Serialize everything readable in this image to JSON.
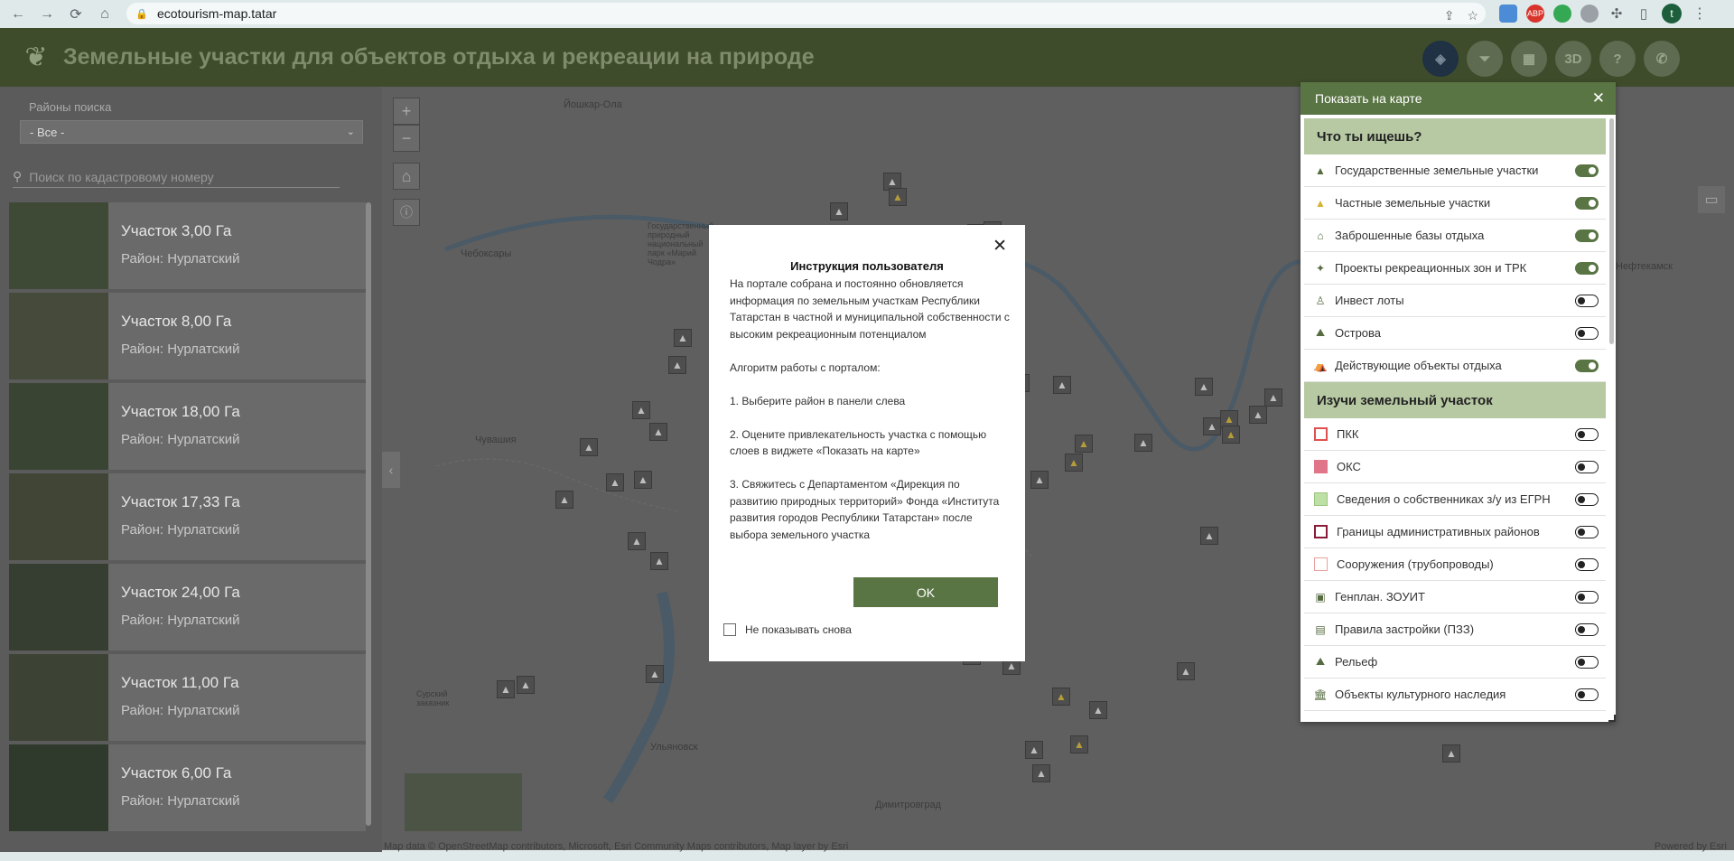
{
  "browser": {
    "url": "ecotourism-map.tatar"
  },
  "header": {
    "title": "Земельные участки для объектов отдыха и рекреации на природе",
    "buttons": [
      "layers",
      "filter",
      "table",
      "3D",
      "help",
      "phone"
    ],
    "btn_3d": "3D",
    "btn_help": "?"
  },
  "sidebar": {
    "district_label": "Районы поиска",
    "district_value": "- Все -",
    "search_placeholder": "Поиск по кадастровому номеру",
    "items": [
      {
        "title": "Участок 3,00 Га",
        "district": "Район: Нурлатский"
      },
      {
        "title": "Участок 8,00 Га",
        "district": "Район: Нурлатский"
      },
      {
        "title": "Участок 18,00 Га",
        "district": "Район: Нурлатский"
      },
      {
        "title": "Участок 17,33 Га",
        "district": "Район: Нурлатский"
      },
      {
        "title": "Участок 24,00 Га",
        "district": "Район: Нурлатский"
      },
      {
        "title": "Участок 11,00 Га",
        "district": "Район: Нурлатский"
      },
      {
        "title": "Участок 6,00 Га",
        "district": "Район: Нурлатский"
      }
    ]
  },
  "map": {
    "labels": {
      "yoshkar_ola": "Йошкар-Ола",
      "cheboksary": "Чебоксары",
      "chuvashia": "Чувашия",
      "ulyanovsk": "Ульяновск",
      "dimitrovgrad": "Димитровград",
      "neftekamsk": "Нефтекамск",
      "park": "Государственный природный национальный парк «Марий Чодра»",
      "sursky": "Сурский заказник"
    },
    "attribution": "Map data © OpenStreetMap contributors, Microsoft, Esri Community Maps contributors, Map layer by Esri",
    "powered": "Powered by Esri"
  },
  "layers_panel": {
    "title": "Показать на карте",
    "section1": "Что ты ищешь?",
    "rows1": [
      {
        "label": "Государственные земельные участки",
        "on": true
      },
      {
        "label": "Частные земельные участки",
        "on": true
      },
      {
        "label": "Заброшенные базы отдыха",
        "on": true
      },
      {
        "label": "Проекты рекреационных зон и ТРК",
        "on": true
      },
      {
        "label": "Инвест лоты",
        "on": false
      },
      {
        "label": "Острова",
        "on": false
      },
      {
        "label": "Действующие объекты отдыха",
        "on": true
      }
    ],
    "section2": "Изучи земельный участок",
    "rows2": [
      {
        "label": "ПКК",
        "on": false
      },
      {
        "label": "ОКС",
        "on": false
      },
      {
        "label": "Сведения о собственниках з/у из ЕГРН",
        "on": false
      },
      {
        "label": "Границы административных районов",
        "on": false
      },
      {
        "label": "Сооружения (трубопроводы)",
        "on": false
      },
      {
        "label": "Генплан. ЗОУИТ",
        "on": false
      },
      {
        "label": "Правила застройки (ПЗЗ)",
        "on": false
      },
      {
        "label": "Рельеф",
        "on": false
      },
      {
        "label": "Объекты культурного наследия",
        "on": false
      }
    ]
  },
  "modal": {
    "title": "Инструкция пользователя",
    "p1": "На портале собрана и постоянно обновляется информация по земельным участкам Республики Татарстан в частной и муниципальной собственности с высоким рекреационным потенциалом",
    "p2": "Алгоритм работы с порталом:",
    "p3": "1. Выберите район в панели слева",
    "p4": "2. Оцените привлекательность участка с помощью слоев в виджете «Показать на карте»",
    "p5": "3. Свяжитесь с Департаментом «Дирекция по развитию природных территорий» Фонда «Института развития городов Республики Татарстан» после выбора земельного участка",
    "ok": "OK",
    "dont_show": "Не показывать снова"
  },
  "colors": {
    "header_bg": "#3e4c2b",
    "accent": "#5a7544",
    "section_bg": "#b7c9a3"
  }
}
